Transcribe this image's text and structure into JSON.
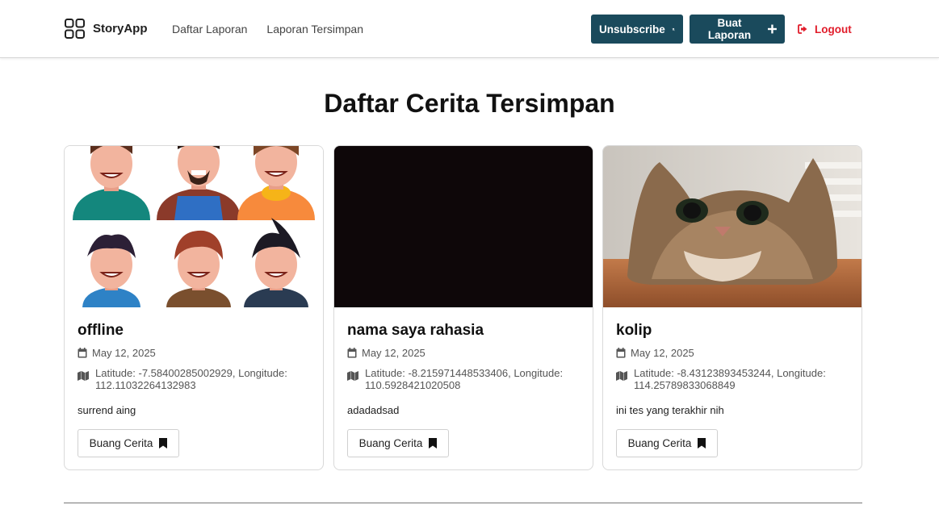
{
  "header": {
    "brand": "StoryApp",
    "nav": [
      "Daftar Laporan",
      "Laporan Tersimpan"
    ],
    "unsubscribe_label": "Unsubscribe",
    "buat_laporan_label": "Buat Laporan",
    "logout_label": "Logout",
    "colors": {
      "primary": "#1a4a5c",
      "logout": "#e11d2b"
    }
  },
  "page": {
    "title": "Daftar Cerita Tersimpan"
  },
  "stories": [
    {
      "title": "offline",
      "date": "May 12, 2025",
      "location": "Latitude: -7.58400285002929, Longitude: 112.11032264132983",
      "description": "surrend aing",
      "button_label": "Buang Cerita",
      "image": "cartoon-avatars"
    },
    {
      "title": "nama saya rahasia",
      "date": "May 12, 2025",
      "location": "Latitude: -8.215971448533406, Longitude: 110.5928421020508",
      "description": "adadadsad",
      "button_label": "Buang Cerita",
      "image": "dark-photo"
    },
    {
      "title": "kolip",
      "date": "May 12, 2025",
      "location": "Latitude: -8.43123893453244, Longitude: 114.25789833068849",
      "description": "ini tes yang terakhir nih",
      "button_label": "Buang Cerita",
      "image": "cat-photo"
    }
  ]
}
